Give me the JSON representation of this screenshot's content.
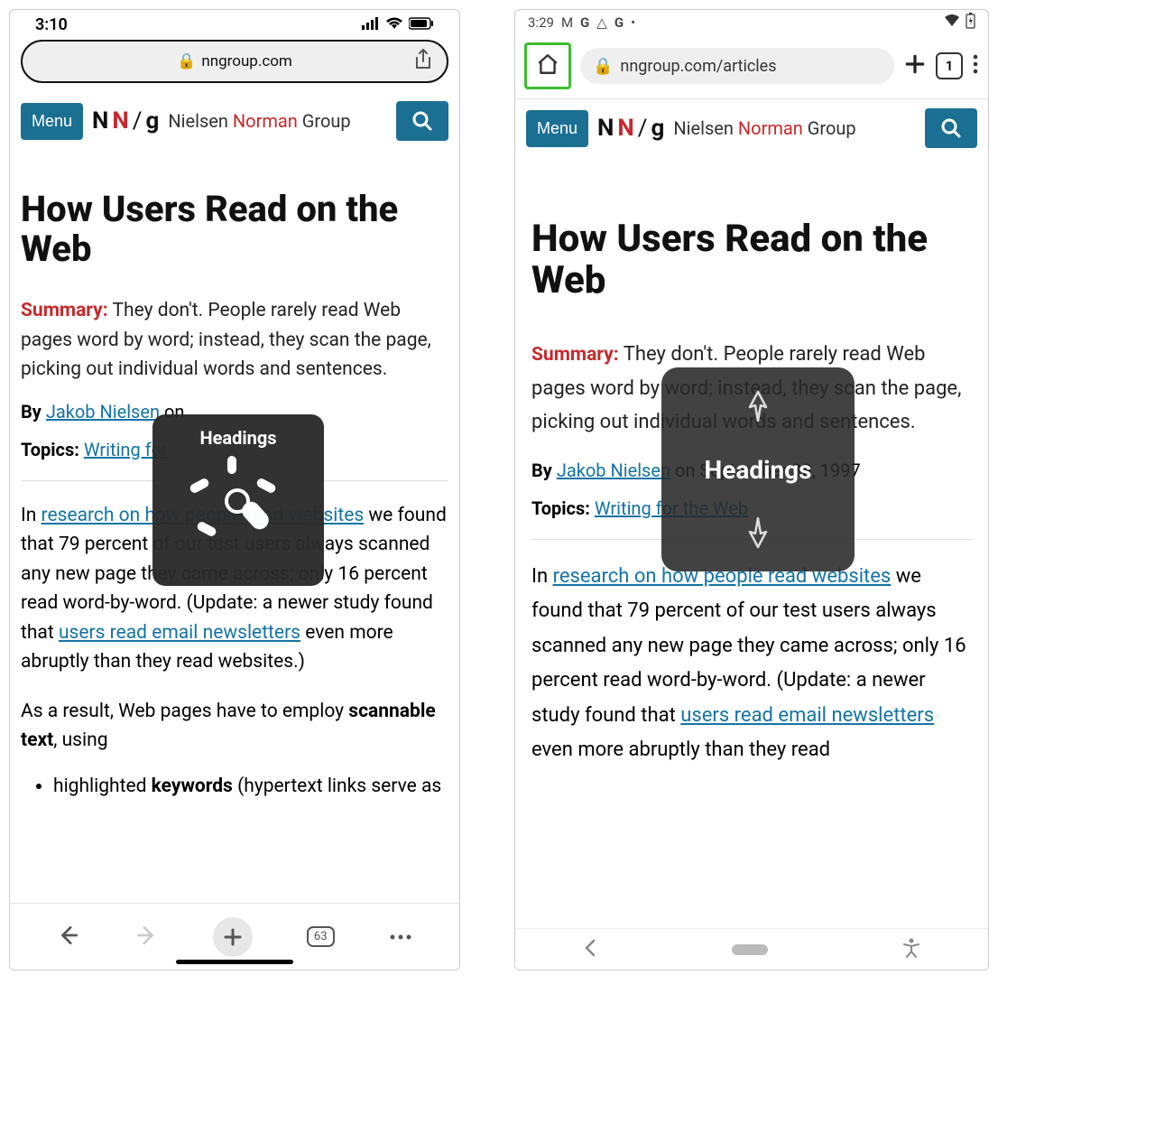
{
  "ios": {
    "status": {
      "time": "3:10"
    },
    "addr": "nngroup.com",
    "tabs": "63"
  },
  "android": {
    "status": {
      "time": "3:29"
    },
    "addr": "nngroup.com/articles",
    "tabs": "1"
  },
  "nng": {
    "menu": "Menu",
    "brand_nielsen": "Nielsen",
    "brand_norman": "Norman",
    "brand_group": "Group"
  },
  "article": {
    "title": "How Users Read on the Web",
    "summary_label": "Summary:",
    "summary_text_ios": " They don't. People rarely read Web pages word by word; instead, they scan the page, picking out individual words and sentences.",
    "summary_text_and": " They don't. People rarely read Web pages word by word; instead, they scan the page, picking out individual words and sentences.",
    "by": "By ",
    "author": "Jakob Nielsen",
    "on_ios": " on",
    "on_and": " on September 30, 1997",
    "topics_label": "Topics:",
    "topics_link_ios": "Writing for",
    "topics_link_and": "Writing for the Web",
    "para1_a": "In ",
    "para1_link1": "research on how people read websites",
    "para1_b": " we found that 79 percent of our test users always scanned any new page they came across; only 16 percent read word-by-word. (Update: a newer study found that ",
    "para1_link2": "users read email newsletters",
    "para1_c_ios": " even more abruptly than they read websites.)",
    "para1_c_and": " even more abruptly than they read",
    "para2_a": "As a result, Web pages have to employ ",
    "para2_b": "scannable text",
    "para2_c": ", using",
    "bullet1_a": "highlighted ",
    "bullet1_b": "keywords",
    "bullet1_c": " (hypertext links serve as"
  },
  "rotor": {
    "label": "Headings"
  }
}
